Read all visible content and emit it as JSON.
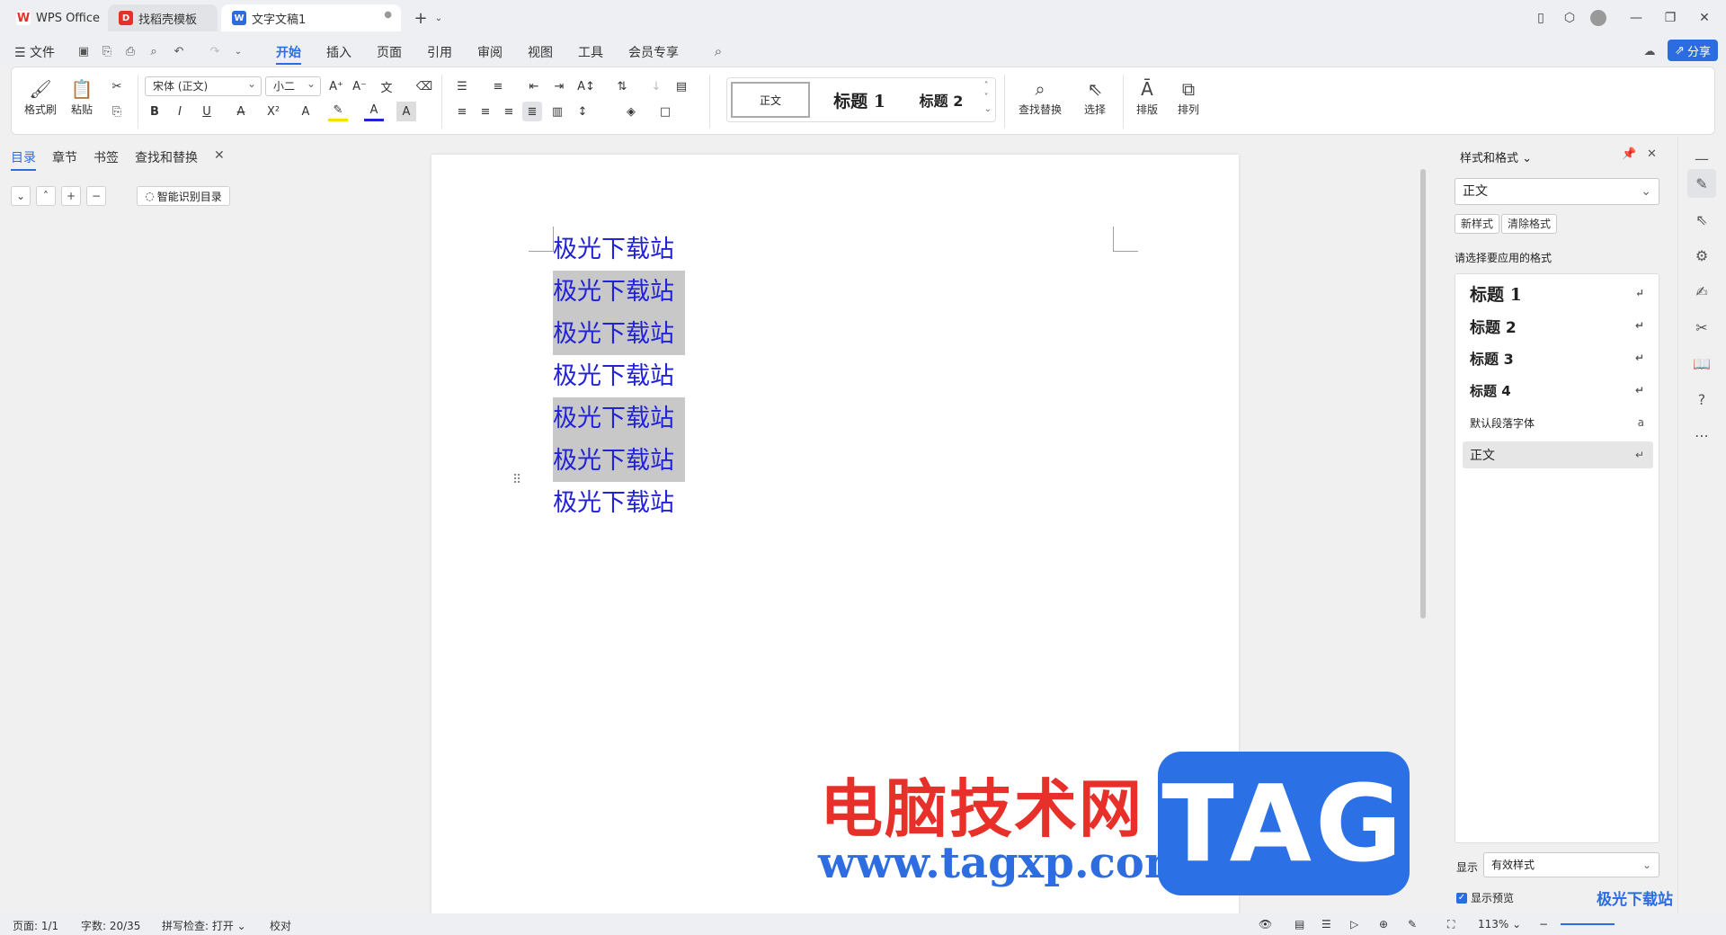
{
  "titlebar": {
    "tabs": [
      {
        "label": "WPS Office",
        "icon": "wps-logo-icon"
      },
      {
        "label": "找稻壳模板",
        "icon": "docer-icon"
      },
      {
        "label": "文字文稿1",
        "icon": "word-doc-icon"
      }
    ],
    "new_tab": "+",
    "window_controls": [
      "minimize",
      "restore",
      "close"
    ]
  },
  "menubar": {
    "file": "文件",
    "items": [
      "开始",
      "插入",
      "页面",
      "引用",
      "审阅",
      "视图",
      "工具",
      "会员专享"
    ],
    "active": "开始",
    "share": "分享"
  },
  "ribbon": {
    "format_painter": "格式刷",
    "paste": "粘贴",
    "font_name": "宋体 (正文)",
    "font_size": "小二",
    "styles": [
      "正文",
      "标题 1",
      "标题 2"
    ],
    "find_replace": "查找替换",
    "select": "选择",
    "layout": "排版",
    "arrange": "排列"
  },
  "left_panel": {
    "tabs": [
      "目录",
      "章节",
      "书签",
      "查找和替换"
    ],
    "active_tab": "目录",
    "smart_toc": "智能识别目录"
  },
  "document": {
    "paragraphs": [
      {
        "text": "极光下载站",
        "selected": false
      },
      {
        "text": "极光下载站",
        "selected": true
      },
      {
        "text": "极光下载站",
        "selected": true
      },
      {
        "text": "极光下载站",
        "selected": false
      },
      {
        "text": "极光下载站",
        "selected": true
      },
      {
        "text": "极光下载站",
        "selected": true
      },
      {
        "text": "极光下载站",
        "selected": false
      }
    ],
    "text_color": "#2222d6",
    "selection_color": "#c8c8c8"
  },
  "watermark": {
    "line1": "电脑技术网",
    "line2": "www.tagxp.com",
    "badge": "TAG",
    "corner": "极光下载站"
  },
  "right_panel": {
    "title": "样式和格式",
    "current_style": "正文",
    "new_style": "新样式",
    "clear_format": "清除格式",
    "prompt": "请选择要应用的格式",
    "styles": [
      {
        "label": "标题  1",
        "mark": "↵"
      },
      {
        "label": "标题  2",
        "mark": "↵"
      },
      {
        "label": "标题  3",
        "mark": "↵"
      },
      {
        "label": "标题  4",
        "mark": "↵"
      },
      {
        "label": "默认段落字体",
        "mark": "a"
      },
      {
        "label": "正文",
        "mark": "↵"
      }
    ],
    "show_label": "显示",
    "show_value": "有效样式",
    "preview_label": "显示预览"
  },
  "statusbar": {
    "page": "页面: 1/1",
    "words": "字数: 20/35",
    "spell": "拼写检查: 打开",
    "proof": "校对",
    "zoom": "113%"
  },
  "colors": {
    "accent": "#2b6de0",
    "share_btn": "#2b6de0"
  }
}
